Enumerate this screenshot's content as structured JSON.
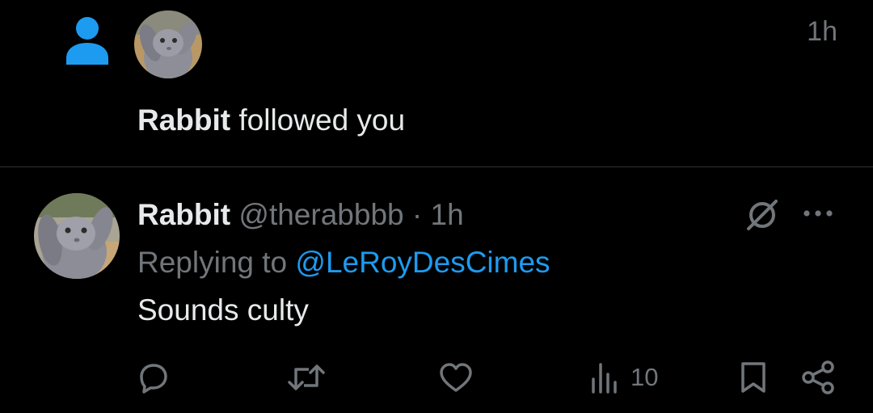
{
  "notification": {
    "icon": "person-icon",
    "icon_color": "#1d9bf0",
    "time": "1h",
    "actor_name": "Rabbit",
    "action_text": " followed you"
  },
  "tweet": {
    "display_name": "Rabbit",
    "handle": "@therabbbb",
    "separator": "·",
    "time": "1h",
    "replying_prefix": "Replying to ",
    "replying_to": "@LeRoyDesCimes",
    "text": "Sounds culty",
    "views": "10"
  },
  "colors": {
    "background": "#000000",
    "text_primary": "#e7e9ea",
    "text_secondary": "#71767b",
    "accent": "#1d9bf0",
    "divider": "#2f3336"
  }
}
